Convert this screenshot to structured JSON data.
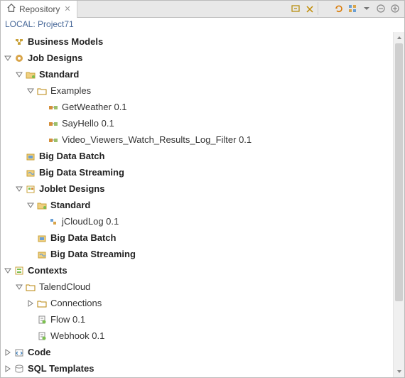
{
  "tab": {
    "title": "Repository"
  },
  "toolbar": {
    "icons": [
      "collapse-all",
      "link-editor",
      "refresh-orange",
      "open-perspective",
      "view-menu",
      "minimize",
      "maximize"
    ]
  },
  "project": {
    "label": "LOCAL: Project71"
  },
  "tree": {
    "business_models": "Business Models",
    "job_designs": "Job Designs",
    "standard": "Standard",
    "examples": "Examples",
    "items_examples": [
      "GetWeather 0.1",
      "SayHello 0.1",
      "Video_Viewers_Watch_Results_Log_Filter 0.1"
    ],
    "big_data_batch": "Big Data Batch",
    "big_data_streaming": "Big Data Streaming",
    "joblet_designs": "Joblet Designs",
    "joblet_standard": "Standard",
    "joblet_items": [
      "jCloudLog 0.1"
    ],
    "joblet_bdb": "Big Data Batch",
    "joblet_bds": "Big Data Streaming",
    "contexts": "Contexts",
    "talend_cloud": "TalendCloud",
    "connections": "Connections",
    "context_items": [
      "Flow 0.1",
      "Webhook 0.1"
    ],
    "code": "Code",
    "sql_templates": "SQL Templates"
  }
}
